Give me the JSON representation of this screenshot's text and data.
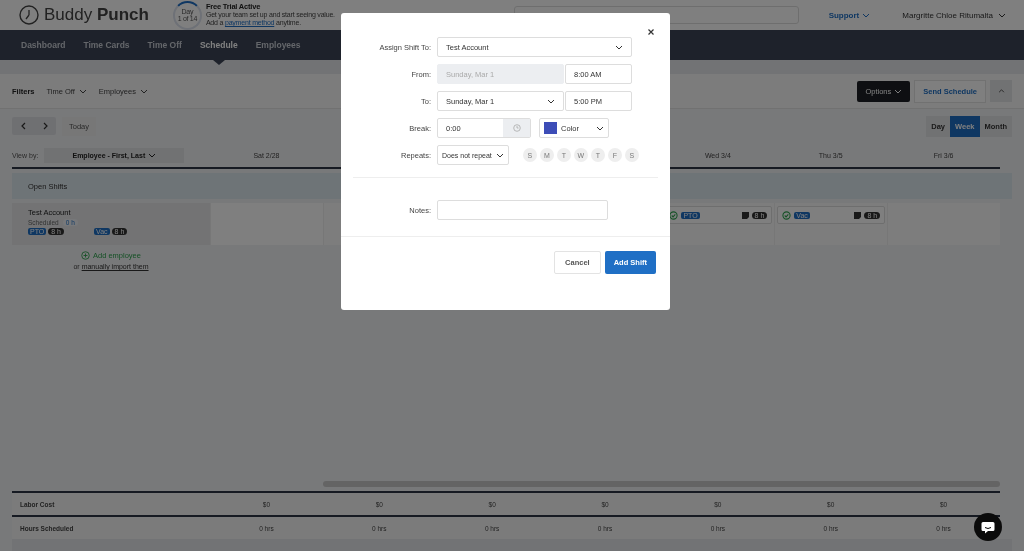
{
  "header": {
    "logo": "Buddy Punch",
    "trial": {
      "day_label": "Day",
      "day_count": "1 of 14",
      "title": "Free Trial Active",
      "line1": "Get your team set up and start seeing value.",
      "line2_before": "Add a",
      "link": "payment method",
      "line2_after": "anytime."
    },
    "support": "Support",
    "user": "Margritte Chloe Ritumalta"
  },
  "nav": [
    {
      "label": "Dashboard",
      "selected": false
    },
    {
      "label": "Time Cards",
      "selected": false
    },
    {
      "label": "Time Off",
      "selected": false
    },
    {
      "label": "Schedule",
      "selected": true
    },
    {
      "label": "Employees",
      "selected": false
    }
  ],
  "filters": {
    "label": "Filters",
    "dropdowns": [
      "Time Off",
      "Employees"
    ]
  },
  "toolbar": {
    "options": "Options",
    "send": "Send Schedule",
    "today": "Today",
    "views": [
      {
        "label": "Day",
        "selected": false
      },
      {
        "label": "Week",
        "selected": true
      },
      {
        "label": "Month",
        "selected": false
      }
    ]
  },
  "schedule": {
    "view_by_label": "View by:",
    "view_by": "Employee - First, Last",
    "first_day": "Sat 2/28",
    "last_days": [
      "Wed 3/4",
      "Thu 3/5",
      "Fri 3/6"
    ],
    "open_shifts": "Open Shifts",
    "employee": {
      "name": "Test Account",
      "scheduled_label": "Scheduled",
      "scheduled": "0 h",
      "time_off": [
        {
          "tag": "PTO",
          "hours": "8 h"
        },
        {
          "tag": "Vac",
          "hours": "8 h"
        }
      ]
    },
    "shift_cards": [
      {
        "tag": "PTO",
        "hours": "8 h"
      },
      {
        "tag": "Vac",
        "hours": "8 h"
      }
    ],
    "add_employee": "Add employee",
    "import_before": "or",
    "import_link": "manually import them"
  },
  "totals": [
    {
      "label": "Labor Cost",
      "values": [
        "$0",
        "$0",
        "$0",
        "$0",
        "$0",
        "$0",
        "$0"
      ]
    },
    {
      "label": "Hours Scheduled",
      "values": [
        "0 hrs",
        "0 hrs",
        "0 hrs",
        "0 hrs",
        "0 hrs",
        "0 hrs",
        "0 hrs"
      ]
    }
  ],
  "modal": {
    "assign_label": "Assign Shift To:",
    "assign_value": "Test Account",
    "from_label": "From:",
    "from_date": "Sunday, Mar 1",
    "from_time": "8:00 AM",
    "to_label": "To:",
    "to_date": "Sunday, Mar 1",
    "to_time": "5:00 PM",
    "break_label": "Break:",
    "break_value": "0:00",
    "color_label": "Color",
    "repeats_label": "Repeats:",
    "repeats_value": "Does not repeat",
    "repeat_days": [
      {
        "label": "S",
        "selected": false
      },
      {
        "label": "M",
        "selected": false
      },
      {
        "label": "T",
        "selected": false
      },
      {
        "label": "W",
        "selected": false
      },
      {
        "label": "T",
        "selected": false
      },
      {
        "label": "F",
        "selected": false
      },
      {
        "label": "S",
        "selected": false
      }
    ],
    "notes_label": "Notes:",
    "cancel": "Cancel",
    "submit": "Add Shift"
  }
}
